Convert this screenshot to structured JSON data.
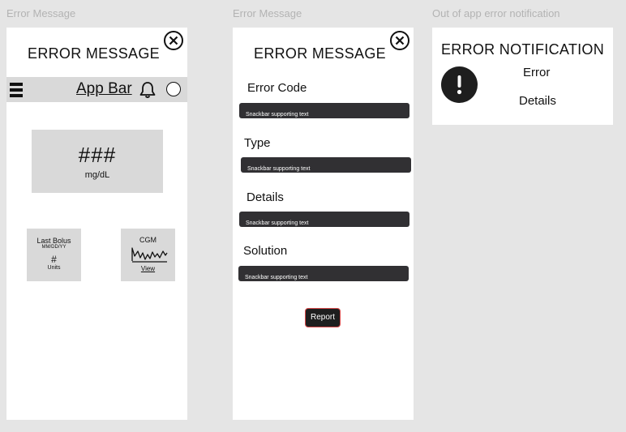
{
  "frame_labels": {
    "error_message_1": "Error Message",
    "error_message_2": "Error Message",
    "notification": "Out of app error notification"
  },
  "screen1": {
    "title": "ERROR MESSAGE",
    "app_bar": {
      "title": "App Bar",
      "menu_icon": "hamburger-menu-icon",
      "bell_icon": "bell-icon",
      "profile_icon": "circle-icon"
    },
    "glucose": {
      "value": "###",
      "unit": "mg/dL"
    },
    "last_bolus": {
      "title": "Last Bolus",
      "date": "MM/DD/YY",
      "value": "#",
      "units": "Units"
    },
    "cgm": {
      "title": "CGM",
      "link": "View"
    }
  },
  "screen2": {
    "title": "ERROR MESSAGE",
    "fields": [
      {
        "label": "Error Code",
        "snackbar": "Snackbar supporting text"
      },
      {
        "label": "Type",
        "snackbar": "Snackbar supporting text"
      },
      {
        "label": "Details",
        "snackbar": "Snackbar supporting text"
      },
      {
        "label": "Solution",
        "snackbar": "Snackbar supporting text"
      }
    ],
    "report_button": "Report"
  },
  "screen3": {
    "title": "ERROR NOTIFICATION",
    "error_label": "Error",
    "details_label": "Details",
    "alert_icon": "exclamation-icon"
  },
  "colors": {
    "canvas": "#e5e5e5",
    "frame": "#ffffff",
    "card": "#d9d9d9",
    "snackbar": "#313033",
    "button": "#1e1e1e",
    "button_border": "#d94a4a",
    "label": "#b3b3b3"
  }
}
